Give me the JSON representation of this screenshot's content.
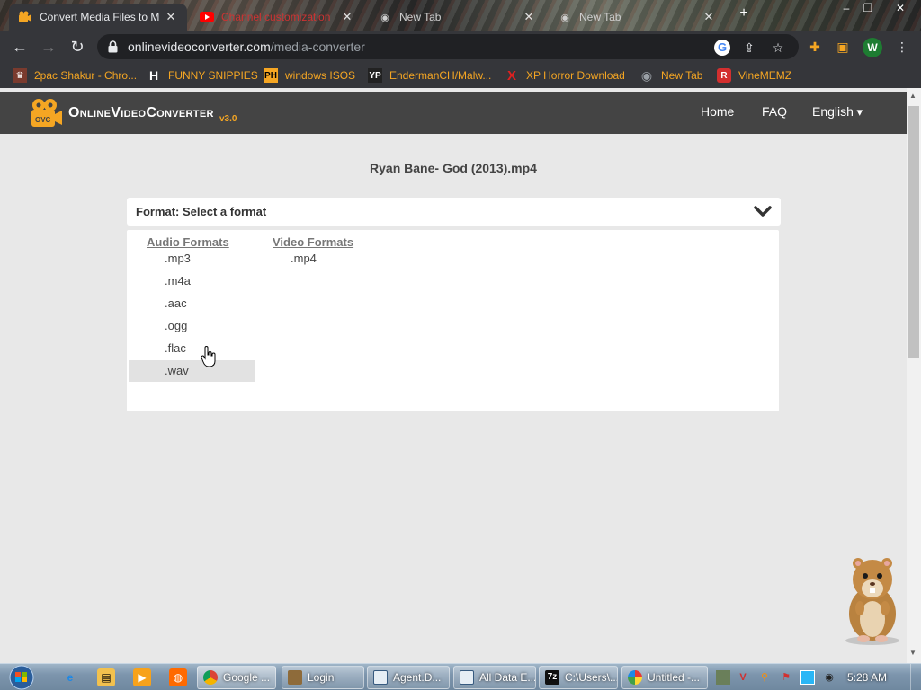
{
  "browser": {
    "tabs": [
      {
        "title": "Convert Media Files to M",
        "icon": "ovc-camera-icon",
        "active": true
      },
      {
        "title": "Channel customization",
        "icon": "youtube-icon",
        "active": false
      },
      {
        "title": "New Tab",
        "icon": "chrome-icon",
        "active": false
      },
      {
        "title": "New Tab",
        "icon": "chrome-icon",
        "active": false
      }
    ],
    "url_host": "onlinevideoconverter.com",
    "url_path": "/media-converter",
    "avatar_letter": "W",
    "bookmarks": [
      {
        "label": "2pac Shakur - Chro...",
        "icon": "tupac-icon",
        "glyph": "♛"
      },
      {
        "label": "FUNNY SNIPPIES",
        "icon": "h-icon",
        "glyph": "H"
      },
      {
        "label": "windows ISOS",
        "icon": "ph-icon",
        "glyph": "PH"
      },
      {
        "label": "EndermanCH/Malw...",
        "icon": "yp-icon",
        "glyph": "YP"
      },
      {
        "label": "XP Horror Download",
        "icon": "x-icon",
        "glyph": "X"
      },
      {
        "label": "New Tab",
        "icon": "chrome-icon",
        "glyph": "◉"
      },
      {
        "label": "VineMEMZ",
        "icon": "r-icon",
        "glyph": "R"
      }
    ]
  },
  "site": {
    "logo_text_1": "Online",
    "logo_text_2": "Video",
    "logo_text_3": "Converter",
    "logo_version": "v3.0",
    "nav": {
      "home": "Home",
      "faq": "FAQ",
      "language": "English"
    }
  },
  "converter": {
    "file_name": "Ryan Bane- God (2013).mp4",
    "format_label": "Format: Select a format",
    "audio_heading": "Audio Formats",
    "video_heading": "Video Formats",
    "audio_formats": [
      ".mp3",
      ".m4a",
      ".aac",
      ".ogg",
      ".flac",
      ".wav"
    ],
    "video_formats": [
      ".mp4"
    ],
    "hovered_format": ".wav"
  },
  "taskbar": {
    "tasks": [
      {
        "label": "Google ...",
        "icon": "chrome-icon",
        "active": true
      },
      {
        "label": "Login",
        "icon": "bonzi-icon",
        "active": false
      },
      {
        "label": "Agent.D...",
        "icon": "window-icon",
        "active": false
      },
      {
        "label": "All Data E...",
        "icon": "window-icon",
        "active": false
      },
      {
        "label": "C:\\Users\\...",
        "icon": "7zip-icon",
        "active": false
      },
      {
        "label": "Untitled -...",
        "icon": "paint-icon",
        "active": false
      }
    ],
    "clock": "5:28 AM"
  },
  "colors": {
    "accent_orange": "#f5a623",
    "header_bg": "#444444",
    "page_bg": "#e8e8e8",
    "chrome_dark": "#35363a"
  }
}
